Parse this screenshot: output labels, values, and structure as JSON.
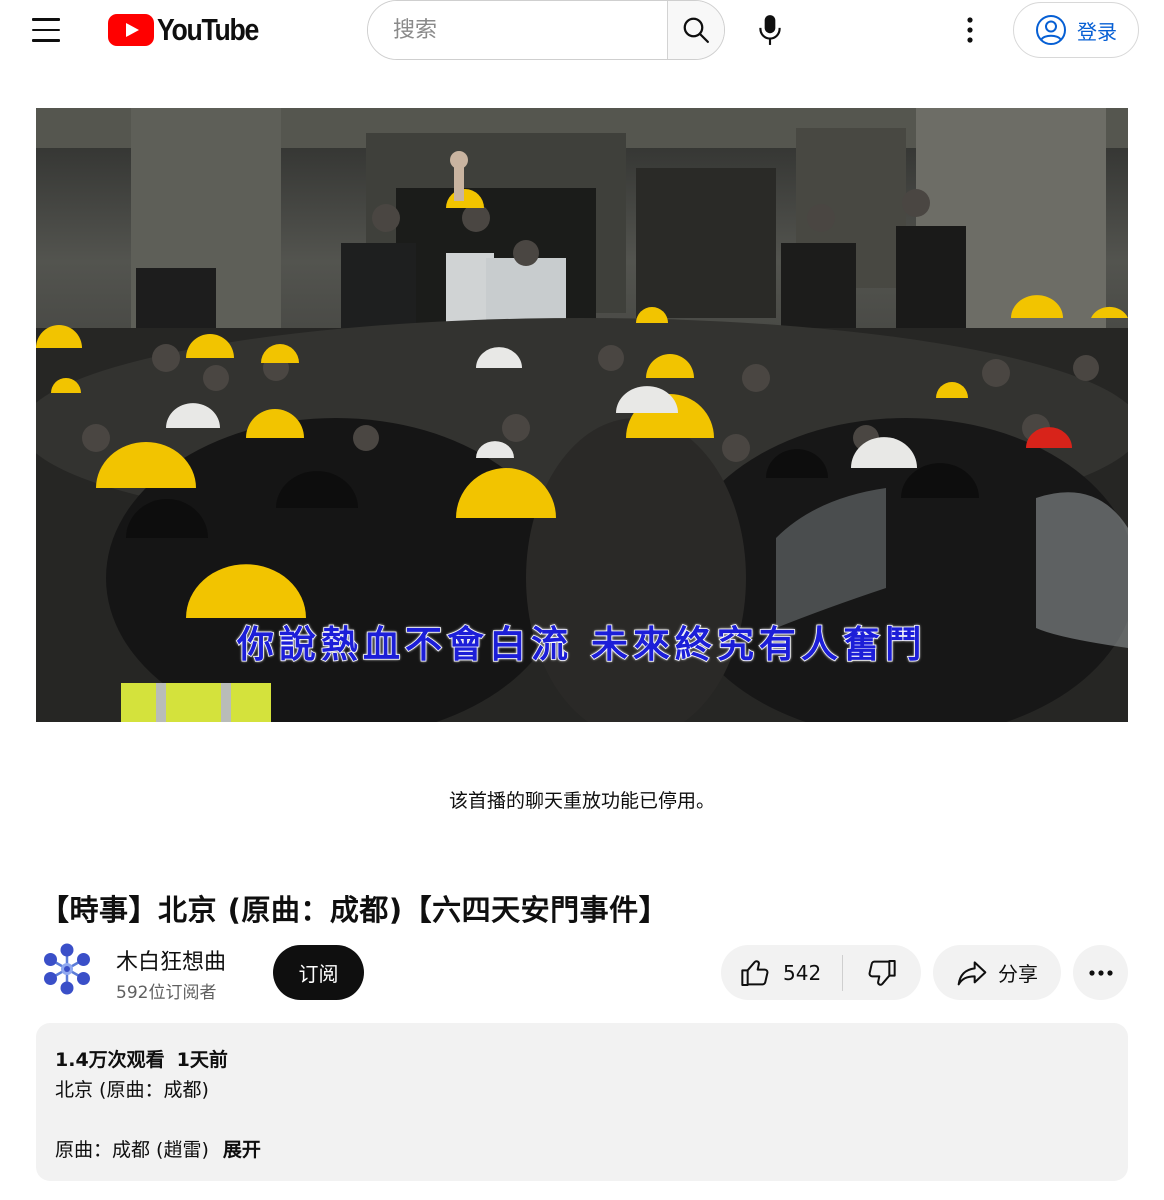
{
  "header": {
    "logo_text": "YouTube",
    "search_placeholder": "搜索",
    "signin_label": "登录"
  },
  "video": {
    "subtitle": "你說熱血不會白流 未來終究有人奮鬥",
    "chat_replay_notice": "该首播的聊天重放功能已停用。"
  },
  "title": "【時事】北京 (原曲：成都)【六四天安門事件】",
  "channel": {
    "name": "木白狂想曲",
    "subscribers": "592位订阅者",
    "subscribe_label": "订阅"
  },
  "actions": {
    "like_count": "542",
    "share_label": "分享"
  },
  "description": {
    "views": "1.4万次观看",
    "age": "1天前",
    "line1": "北京 (原曲：成都)",
    "line2": "原曲：成都 (趙雷)",
    "expand_label": "展开"
  },
  "colors": {
    "brand_red": "#ff0000",
    "link_blue": "#065fd4",
    "subtitle_blue": "#1c1ed8",
    "helmet_yellow": "#f2c400"
  },
  "icons": [
    "menu-icon",
    "search-icon",
    "mic-icon",
    "more-vert-icon",
    "account-icon",
    "like-icon",
    "dislike-icon",
    "share-icon",
    "more-horiz-icon"
  ]
}
